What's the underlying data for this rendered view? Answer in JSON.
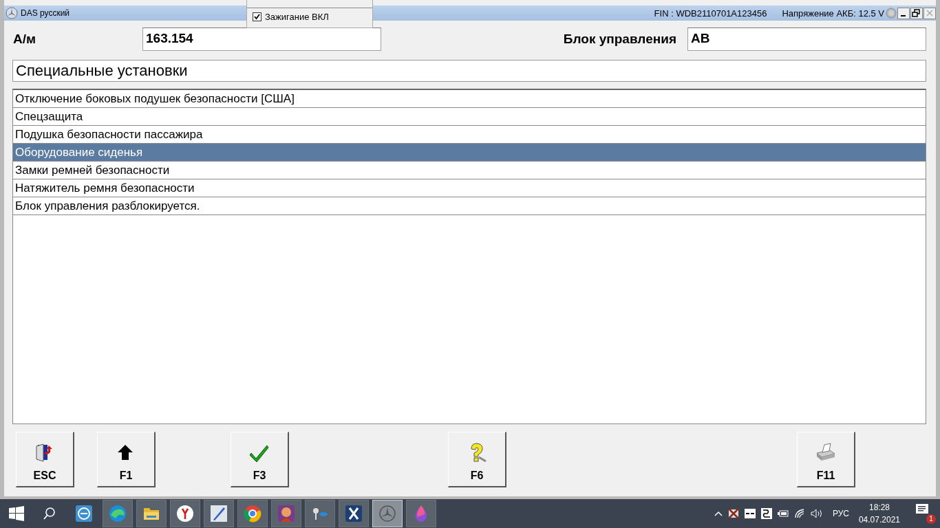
{
  "window": {
    "title": "DAS русский",
    "fin": "FIN : WDB2110701A123456",
    "voltage": "Напряжение АКБ: 12.5 V"
  },
  "popup": {
    "items": [
      {
        "label": "Зажигание ВКЛ",
        "checked": true
      }
    ]
  },
  "header": {
    "vehicle_label": "А/м",
    "vehicle_value": "163.154",
    "unit_label": "Блок управления",
    "unit_value": "AB"
  },
  "section_title": "Специальные установки",
  "list": [
    {
      "label": "Отключение боковых подушек безопасности [США]",
      "selected": false
    },
    {
      "label": "Спецзащита",
      "selected": false
    },
    {
      "label": "Подушка безопасности пассажира",
      "selected": false
    },
    {
      "label": "Оборудование сиденья",
      "selected": true
    },
    {
      "label": "Замки ремней безопасности",
      "selected": false
    },
    {
      "label": "Натяжитель ремня безопасности",
      "selected": false
    },
    {
      "label": "Блок управления разблокируется.",
      "selected": false
    }
  ],
  "function_keys": [
    {
      "key": "ESC"
    },
    {
      "key": "F1"
    },
    {
      "key": "F3"
    },
    {
      "key": "F6"
    },
    {
      "key": "F11"
    }
  ],
  "taskbar": {
    "apps": [
      {
        "running": false,
        "selected": false
      },
      {
        "running": true,
        "selected": false
      },
      {
        "running": true,
        "selected": false
      },
      {
        "running": true,
        "selected": false
      },
      {
        "running": true,
        "selected": false
      },
      {
        "running": true,
        "selected": false
      },
      {
        "running": true,
        "selected": false
      },
      {
        "running": true,
        "selected": false
      },
      {
        "running": true,
        "selected": false
      },
      {
        "running": true,
        "selected": true
      },
      {
        "running": true,
        "selected": false
      }
    ],
    "language": "РУС",
    "time": "18:28",
    "date": "04.07.2021",
    "notifications": "1"
  }
}
